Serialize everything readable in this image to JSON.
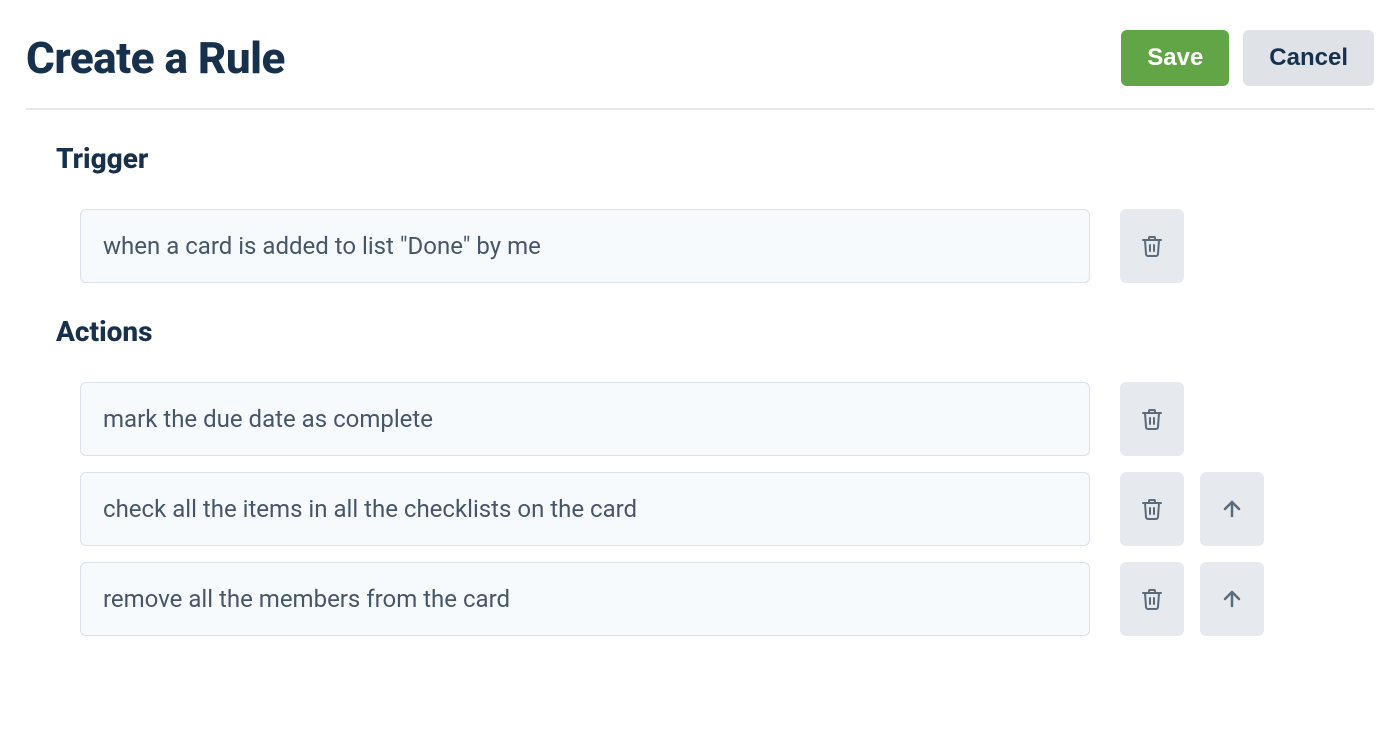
{
  "header": {
    "title": "Create a Rule",
    "save_label": "Save",
    "cancel_label": "Cancel"
  },
  "sections": {
    "trigger": {
      "heading": "Trigger",
      "items": [
        {
          "text": "when a card is added to list \"Done\" by me",
          "has_move_up": false
        }
      ]
    },
    "actions": {
      "heading": "Actions",
      "items": [
        {
          "text": "mark the due date as complete",
          "has_move_up": false
        },
        {
          "text": "check all the items in all the checklists on the card",
          "has_move_up": true
        },
        {
          "text": "remove all the members from the card",
          "has_move_up": true
        }
      ]
    }
  }
}
